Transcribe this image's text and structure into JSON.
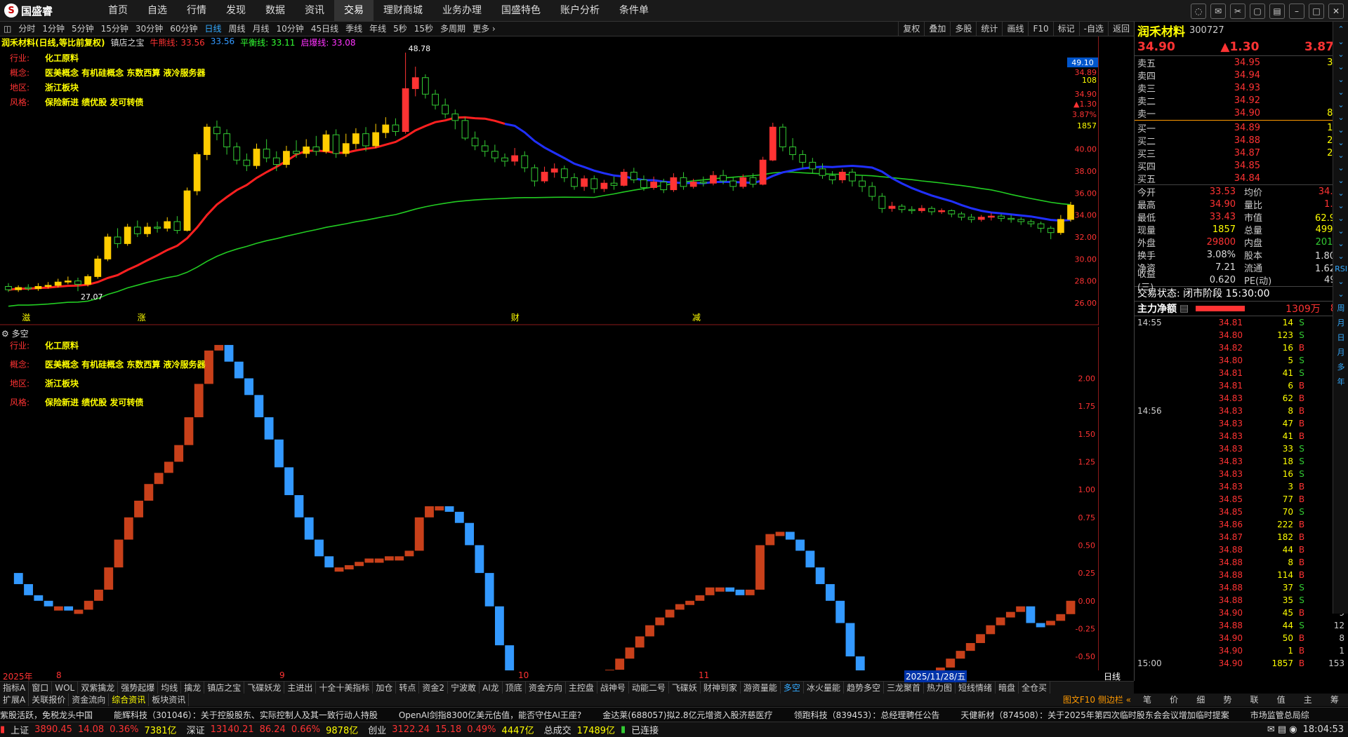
{
  "app": {
    "logo_text": "国盛睿",
    "logo_mark": "S"
  },
  "menu": [
    "首页",
    "自选",
    "行情",
    "发现",
    "数据",
    "资讯",
    "交易",
    "理财商城",
    "业务办理",
    "国盛特色",
    "账户分析",
    "条件单"
  ],
  "menu_active": 6,
  "periods": [
    "分时",
    "1分钟",
    "5分钟",
    "15分钟",
    "30分钟",
    "60分钟",
    "日线",
    "周线",
    "月线",
    "10分钟",
    "45日线",
    "季线",
    "年线",
    "5秒",
    "15秒",
    "多周期",
    "更多 ›"
  ],
  "period_active": 6,
  "toolbar_right": [
    "复权",
    "叠加",
    "多股",
    "统计",
    "画线",
    "F10",
    "标记",
    "-自选",
    "返回"
  ],
  "chart": {
    "header_title": "润禾材料(日线,等比前复权)",
    "indicator_name": "镇店之宝",
    "ma_items": [
      {
        "label": "牛熊线: 33.56",
        "color": "#ff3333"
      },
      {
        "label": "33.56",
        "color": "#3399ff"
      },
      {
        "label": "平衡线: 33.11",
        "color": "#33ff33"
      },
      {
        "label": "启爆线: 33.08",
        "color": "#ff33ff"
      }
    ],
    "info": [
      {
        "label": "行业:",
        "value": "化工原料"
      },
      {
        "label": "概念:",
        "value": "医美概念 有机硅概念 东数西算 液冷服务器"
      },
      {
        "label": "地区:",
        "value": "浙江板块"
      },
      {
        "label": "风格:",
        "value": "保险新进 绩优股 发可转债"
      }
    ],
    "price_axis": [
      "40.00",
      "38.00",
      "36.00",
      "34.00",
      "32.00",
      "30.00",
      "28.00",
      "26.00"
    ],
    "price_axis_top": [
      "34.89",
      "108",
      "34.90",
      "▲1.30",
      "3.87%",
      "1857"
    ],
    "high_tag": "49.10",
    "high_label": "48.78",
    "low_label": "27.07",
    "sub_title": "多空",
    "sub_axis": [
      "2.00",
      "1.75",
      "1.50",
      "1.25",
      "1.00",
      "0.75",
      "0.50",
      "0.25",
      "0.00",
      "-0.25",
      "-0.50"
    ],
    "date_labels": [
      "2025年",
      "8",
      "9",
      "10",
      "11",
      "2025/11/28/五"
    ],
    "period_label": "日线",
    "bottom_marks": [
      "滋",
      "涨",
      "财",
      "减"
    ]
  },
  "chart_data": {
    "type": "candlestick",
    "candles": [
      [
        27.5,
        27.2,
        27.8,
        27.0
      ],
      [
        27.2,
        27.4,
        27.6,
        27.0
      ],
      [
        27.4,
        27.3,
        27.7,
        27.1
      ],
      [
        27.3,
        27.5,
        27.8,
        27.1
      ],
      [
        27.5,
        27.6,
        27.9,
        27.3
      ],
      [
        27.6,
        27.9,
        28.2,
        27.4
      ],
      [
        27.9,
        28.0,
        28.4,
        27.7
      ],
      [
        28.0,
        27.7,
        28.3,
        27.07
      ],
      [
        27.7,
        28.4,
        28.6,
        27.5
      ],
      [
        28.4,
        30.0,
        30.3,
        28.2
      ],
      [
        30.0,
        32.0,
        32.3,
        29.8
      ],
      [
        32.0,
        31.4,
        32.8,
        31.0
      ],
      [
        31.4,
        32.9,
        33.2,
        31.2
      ],
      [
        32.9,
        32.3,
        33.5,
        32.0
      ],
      [
        32.3,
        32.9,
        33.3,
        32.0
      ],
      [
        32.9,
        32.8,
        33.4,
        32.4
      ],
      [
        32.8,
        33.4,
        33.8,
        32.5
      ],
      [
        33.4,
        32.6,
        33.9,
        32.3
      ],
      [
        32.6,
        36.2,
        36.5,
        32.5
      ],
      [
        36.2,
        39.5,
        39.7,
        35.8
      ],
      [
        39.5,
        42.0,
        42.3,
        39.0
      ],
      [
        42.0,
        41.4,
        42.6,
        40.8
      ],
      [
        41.4,
        40.2,
        41.8,
        39.5
      ],
      [
        40.2,
        39.0,
        40.6,
        38.6
      ],
      [
        39.0,
        38.5,
        39.6,
        38.0
      ],
      [
        38.5,
        40.0,
        40.5,
        38.2
      ],
      [
        40.0,
        39.2,
        40.9,
        38.8
      ],
      [
        39.2,
        38.6,
        39.8,
        38.0
      ],
      [
        38.6,
        39.8,
        40.3,
        38.3
      ],
      [
        39.8,
        39.6,
        40.8,
        39.2
      ],
      [
        39.6,
        40.2,
        40.9,
        39.2
      ],
      [
        40.2,
        39.8,
        41.2,
        39.4
      ],
      [
        39.8,
        41.3,
        41.7,
        39.6
      ],
      [
        41.3,
        39.6,
        41.8,
        39.2
      ],
      [
        39.6,
        40.5,
        41.4,
        39.3
      ],
      [
        40.5,
        41.4,
        41.9,
        40.0
      ],
      [
        41.4,
        40.3,
        42.0,
        39.8
      ],
      [
        40.3,
        41.5,
        42.3,
        40.1
      ],
      [
        41.5,
        42.2,
        42.9,
        41.0
      ],
      [
        42.2,
        41.6,
        42.8,
        41.2
      ],
      [
        41.6,
        45.5,
        48.78,
        41.4
      ],
      [
        45.5,
        46.5,
        47.5,
        44.8
      ],
      [
        46.5,
        45.0,
        46.8,
        44.6
      ],
      [
        45.0,
        44.0,
        45.4,
        43.6
      ],
      [
        44.0,
        43.2,
        44.6,
        42.8
      ],
      [
        43.2,
        42.6,
        43.6,
        41.8
      ],
      [
        42.6,
        41.0,
        42.9,
        40.8
      ],
      [
        41.0,
        40.3,
        41.6,
        39.9
      ],
      [
        40.3,
        39.8,
        40.8,
        39.3
      ],
      [
        39.8,
        39.2,
        40.4,
        38.8
      ],
      [
        39.2,
        38.9,
        39.6,
        38.4
      ],
      [
        38.9,
        39.4,
        40.1,
        38.5
      ],
      [
        39.4,
        38.3,
        39.8,
        37.9
      ],
      [
        38.3,
        37.1,
        38.6,
        36.6
      ],
      [
        37.1,
        37.9,
        38.4,
        36.9
      ],
      [
        37.9,
        38.2,
        38.7,
        37.4
      ],
      [
        38.2,
        37.4,
        38.5,
        37.0
      ],
      [
        37.4,
        36.6,
        37.8,
        36.3
      ],
      [
        36.6,
        37.3,
        37.6,
        36.2
      ],
      [
        37.3,
        36.4,
        37.6,
        36.0
      ],
      [
        36.4,
        36.9,
        37.2,
        36.1
      ],
      [
        36.9,
        36.7,
        37.5,
        36.3
      ],
      [
        36.7,
        37.9,
        38.2,
        36.6
      ],
      [
        37.9,
        37.2,
        38.3,
        36.9
      ],
      [
        37.2,
        36.5,
        37.6,
        36.2
      ],
      [
        36.5,
        37.0,
        37.5,
        36.3
      ],
      [
        37.0,
        36.3,
        37.3,
        36.0
      ],
      [
        36.3,
        37.4,
        37.8,
        36.1
      ],
      [
        37.4,
        36.6,
        37.9,
        36.3
      ],
      [
        36.6,
        37.0,
        37.3,
        36.4
      ],
      [
        37.0,
        36.9,
        37.5,
        36.6
      ],
      [
        36.9,
        37.6,
        38.0,
        36.7
      ],
      [
        37.6,
        37.1,
        38.1,
        36.8
      ],
      [
        37.1,
        36.6,
        37.4,
        36.2
      ],
      [
        36.6,
        37.4,
        37.7,
        36.4
      ],
      [
        37.4,
        36.8,
        37.8,
        36.5
      ],
      [
        36.8,
        39.0,
        39.3,
        36.7
      ],
      [
        39.0,
        42.0,
        42.4,
        38.9
      ],
      [
        42.0,
        40.2,
        42.3,
        39.8
      ],
      [
        40.2,
        39.5,
        41.0,
        39.0
      ],
      [
        39.5,
        38.8,
        39.9,
        38.3
      ],
      [
        38.8,
        38.2,
        39.2,
        37.8
      ],
      [
        38.2,
        37.6,
        38.7,
        37.3
      ],
      [
        37.6,
        37.2,
        38.0,
        36.8
      ],
      [
        37.2,
        37.9,
        38.2,
        36.9
      ],
      [
        37.9,
        37.1,
        38.2,
        36.6
      ],
      [
        37.1,
        36.6,
        37.6,
        36.1
      ],
      [
        36.6,
        35.7,
        37.0,
        35.3
      ],
      [
        35.7,
        34.6,
        36.0,
        34.2
      ],
      [
        34.6,
        34.8,
        35.2,
        34.3
      ],
      [
        34.8,
        34.5,
        35.0,
        34.2
      ],
      [
        34.5,
        34.4,
        34.8,
        34.1
      ],
      [
        34.4,
        34.6,
        34.9,
        34.2
      ],
      [
        34.6,
        34.3,
        34.8,
        34.0
      ],
      [
        34.3,
        34.4,
        34.6,
        34.1
      ],
      [
        34.4,
        34.1,
        34.5,
        33.8
      ],
      [
        34.1,
        33.8,
        34.3,
        33.5
      ],
      [
        33.8,
        33.6,
        34.1,
        33.3
      ],
      [
        33.6,
        33.8,
        34.0,
        33.4
      ],
      [
        33.8,
        33.9,
        34.2,
        33.5
      ],
      [
        33.9,
        33.7,
        34.1,
        33.4
      ],
      [
        33.7,
        33.6,
        34.0,
        33.3
      ],
      [
        33.6,
        33.4,
        33.8,
        33.1
      ],
      [
        33.4,
        33.2,
        33.6,
        32.9
      ],
      [
        33.2,
        32.8,
        33.4,
        32.4
      ],
      [
        32.8,
        32.4,
        33.0,
        31.8
      ],
      [
        32.4,
        33.6,
        34.0,
        32.2
      ],
      [
        33.6,
        34.9,
        35.2,
        33.4
      ]
    ],
    "xlabels": [
      "8",
      "9",
      "10",
      "11",
      "2025/11/28/五"
    ],
    "ylim": [
      26,
      49.1
    ],
    "sub_ylim": [
      -0.55,
      2.35
    ],
    "sub_values": [
      0.25,
      0.15,
      0.05,
      0.0,
      -0.05,
      -0.05,
      -0.08,
      -0.08,
      0.0,
      0.1,
      0.3,
      0.55,
      0.75,
      0.9,
      1.05,
      1.15,
      1.25,
      1.4,
      1.65,
      1.95,
      2.25,
      2.3,
      2.15,
      2.0,
      1.85,
      1.65,
      1.45,
      1.2,
      0.95,
      0.75,
      0.55,
      0.4,
      0.3,
      0.3,
      0.32,
      0.35,
      0.38,
      0.38,
      0.4,
      0.4,
      0.45,
      0.75,
      0.85,
      0.85,
      0.8,
      0.7,
      0.5,
      0.25,
      -0.05,
      -0.4,
      -0.7,
      -0.95,
      -1.05,
      -1.08,
      -1.1,
      -1.05,
      -0.98,
      -0.9,
      -0.82,
      -0.72,
      -0.62,
      -0.52,
      -0.42,
      -0.32,
      -0.22,
      -0.15,
      -0.08,
      -0.03,
      0.0,
      0.05,
      0.12,
      0.12,
      0.1,
      0.05,
      0.1,
      0.5,
      0.6,
      0.62,
      0.55,
      0.45,
      0.3,
      0.15,
      0.0,
      -0.2,
      -0.5,
      -0.8,
      -1.0,
      -1.05,
      -1.05,
      -1.0,
      -0.95,
      -0.85,
      -0.7,
      -0.6,
      -0.52,
      -0.45,
      -0.38,
      -0.3,
      -0.22,
      -0.15,
      -0.1,
      -0.05,
      -0.2,
      -0.22,
      -0.18,
      -0.12,
      0.0
    ]
  },
  "quote": {
    "name": "润禾材料",
    "code": "300727",
    "price": "34.90",
    "change": "▲1.30",
    "pct": "3.87%",
    "sells": [
      [
        "卖五",
        "34.95",
        "321"
      ],
      [
        "卖四",
        "34.94",
        "81"
      ],
      [
        "卖三",
        "34.93",
        "5"
      ],
      [
        "卖二",
        "34.92",
        "49"
      ],
      [
        "卖一",
        "34.90",
        "885"
      ]
    ],
    "buys": [
      [
        "买一",
        "34.89",
        "108"
      ],
      [
        "买二",
        "34.88",
        "220"
      ],
      [
        "买三",
        "34.87",
        "214"
      ],
      [
        "买四",
        "34.85",
        "9"
      ],
      [
        "买五",
        "34.84",
        "53"
      ]
    ],
    "stats": [
      [
        "今开",
        "33.53",
        "均价",
        "34.24"
      ],
      [
        "最高",
        "34.90",
        "量比",
        "1.34"
      ],
      [
        "最低",
        "33.43",
        "市值",
        "62.9亿"
      ],
      [
        "现量",
        "1857",
        "总量",
        "49921"
      ],
      [
        "外盘",
        "29800",
        "内盘",
        "20121"
      ],
      [
        "换手",
        "3.08%",
        "股本",
        "1.80亿"
      ],
      [
        "净资",
        "7.21",
        "流通",
        "1.62亿"
      ],
      [
        "收益(三)",
        "0.620",
        "PE(动)",
        "49.5"
      ]
    ],
    "trade_state": "交易状态: 闭市阶段 15:30:00",
    "main_net_label": "主力净额",
    "main_net_value": "1309万",
    "main_net_pct": "8%",
    "ticks": [
      [
        "14:55",
        "34.81",
        "14",
        "S",
        "4"
      ],
      [
        "",
        "34.80",
        "123",
        "S",
        "16"
      ],
      [
        "",
        "34.82",
        "16",
        "B",
        "6"
      ],
      [
        "",
        "34.80",
        "5",
        "S",
        "3"
      ],
      [
        "",
        "34.81",
        "41",
        "S",
        "6"
      ],
      [
        "",
        "34.81",
        "6",
        "B",
        "3"
      ],
      [
        "",
        "34.83",
        "62",
        "B",
        "9"
      ],
      [
        "14:56",
        "34.83",
        "8",
        "B",
        "2"
      ],
      [
        "",
        "34.83",
        "47",
        "B",
        "29"
      ],
      [
        "",
        "34.83",
        "41",
        "B",
        "20"
      ],
      [
        "",
        "34.83",
        "33",
        "S",
        "14"
      ],
      [
        "",
        "34.83",
        "18",
        "S",
        "16"
      ],
      [
        "",
        "34.83",
        "16",
        "S",
        "5"
      ],
      [
        "",
        "34.83",
        "3",
        "B",
        "8"
      ],
      [
        "",
        "34.85",
        "77",
        "B",
        "18"
      ],
      [
        "",
        "34.85",
        "70",
        "S",
        "13"
      ],
      [
        "",
        "34.86",
        "222",
        "B",
        "22"
      ],
      [
        "",
        "34.87",
        "182",
        "B",
        "28"
      ],
      [
        "",
        "34.88",
        "44",
        "B",
        "10"
      ],
      [
        "",
        "34.88",
        "8",
        "B",
        "5"
      ],
      [
        "",
        "34.88",
        "114",
        "B",
        "24"
      ],
      [
        "",
        "34.88",
        "37",
        "S",
        "7"
      ],
      [
        "",
        "34.88",
        "35",
        "S",
        "8"
      ],
      [
        "",
        "34.90",
        "45",
        "B",
        "9"
      ],
      [
        "",
        "34.88",
        "44",
        "S",
        "12"
      ],
      [
        "",
        "34.90",
        "50",
        "B",
        "8"
      ],
      [
        "",
        "34.90",
        "1",
        "B",
        "1"
      ],
      [
        "15:00",
        "34.90",
        "1857",
        "B",
        "153"
      ]
    ]
  },
  "side_tabs": [
    "⌃",
    "⌄",
    "⌄",
    "⌄",
    "⌄",
    "⌄",
    "⌄",
    "⌄",
    "⌄",
    "⌄",
    "⌄",
    "⌄",
    "⌄",
    "⌄",
    "⌄",
    "⌄",
    "⌄",
    "⌄",
    "⌄",
    "RSI",
    "⌄",
    "⌄",
    "周",
    "月",
    "日",
    "月",
    "多",
    "年"
  ],
  "indicator_tabs": [
    "指标A",
    "窗口",
    "WOL",
    "双紫擒龙",
    "强势起爆",
    "均线",
    "擒龙",
    "镇店之宝",
    "飞碟妖龙",
    "主进出",
    "十全十美指标",
    "加仓",
    "转点",
    "资金2",
    "宁波敢",
    "AI龙",
    "顶底",
    "资金方向",
    "主控盘",
    "战神号",
    "动能二号",
    "飞碟妖",
    "财神到家",
    "游资量能",
    "多空",
    "冰火量能",
    "趋势多空",
    "三龙聚首",
    "热力图",
    "短线情绪",
    "暗盘",
    "全仓买"
  ],
  "indicator_active": 24,
  "bottom_tabs": [
    "扩展A",
    "关联报价",
    "资金流向",
    "综合资讯",
    "板块资讯"
  ],
  "bottom_tabs_active": 3,
  "bottom_right": "图文F10 侧边栏 «",
  "quote_tabs": [
    "笔",
    "价",
    "细",
    "势",
    "联",
    "值",
    "主",
    "筹"
  ],
  "news": [
    "紫股活跃，免税龙头中国",
    "能辉科技（301046）：关于控股股东、实际控制人及其一致行动人持股",
    "OpenAI剑指8300亿美元估值，能否守住AI王座?",
    "金达莱(688057)拟2.8亿元增资入股济慈医疗",
    "领跑科技（839453）：总经理聘任公告",
    "天健新材（874508）：关于2025年第四次临时股东会会议增加临时提案",
    "市场监管总局综"
  ],
  "status": {
    "sh_label": "上证",
    "sh_val": "3890.45",
    "sh_chg": "14.08",
    "sh_pct": "0.36%",
    "sh_amt": "7381亿",
    "sz_label": "深证",
    "sz_val": "13140.21",
    "sz_chg": "86.24",
    "sz_pct": "0.66%",
    "sz_amt": "9878亿",
    "cy_label": "创业",
    "cy_val": "3122.24",
    "cy_chg": "15.18",
    "cy_pct": "0.49%",
    "cy_amt": "4447亿",
    "total_label": "总成交",
    "total_val": "17489亿",
    "conn": "已连接",
    "time": "18:04:53"
  },
  "colors": {
    "up": "#ff3333",
    "down": "#33cc33",
    "bull_line": "#ff2020",
    "bear_line": "#2030ff",
    "balance_line": "#22cc22",
    "sub_up": "#3399ff",
    "sub_down": "#c8401a",
    "label_yellow": "#ffff00"
  }
}
